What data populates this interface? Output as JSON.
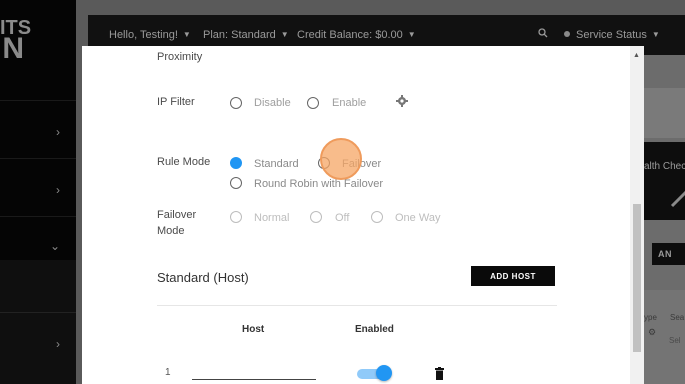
{
  "brand": {
    "line1": "ITS",
    "line2": "N"
  },
  "topnav": {
    "greeting": "Hello, Testing!",
    "plan": "Plan: Standard",
    "credit": "Credit Balance: $0.00",
    "service_status": "Service Status"
  },
  "background": {
    "health_check": "alth Chec",
    "an_button": "AN",
    "type_header": "ype",
    "search_header": "Sea",
    "select_placeholder": "Sel"
  },
  "modal": {
    "proximity_label": "Proximity",
    "ip_filter": {
      "label": "IP Filter",
      "options": [
        "Disable",
        "Enable"
      ]
    },
    "rule_mode": {
      "label": "Rule Mode",
      "options": [
        "Standard",
        "Failover",
        "Round Robin with Failover"
      ],
      "selected": "Standard"
    },
    "failover_mode": {
      "label_line1": "Failover",
      "label_line2": "Mode",
      "options": [
        "Normal",
        "Off",
        "One Way"
      ]
    },
    "section_title": "Standard (Host)",
    "add_host_label": "ADD HOST",
    "table": {
      "headers": [
        "Host",
        "Enabled"
      ],
      "rows": [
        {
          "num": "1",
          "host": "",
          "enabled": true
        }
      ]
    }
  },
  "colors": {
    "accent": "#2196f3",
    "toggle_track": "#90caf9",
    "click_indicator": "#f6a664"
  },
  "icons": [
    "chevron-right-icon",
    "chevron-down-icon",
    "search-icon",
    "gear-icon",
    "trash-icon",
    "arrow-up-icon"
  ]
}
